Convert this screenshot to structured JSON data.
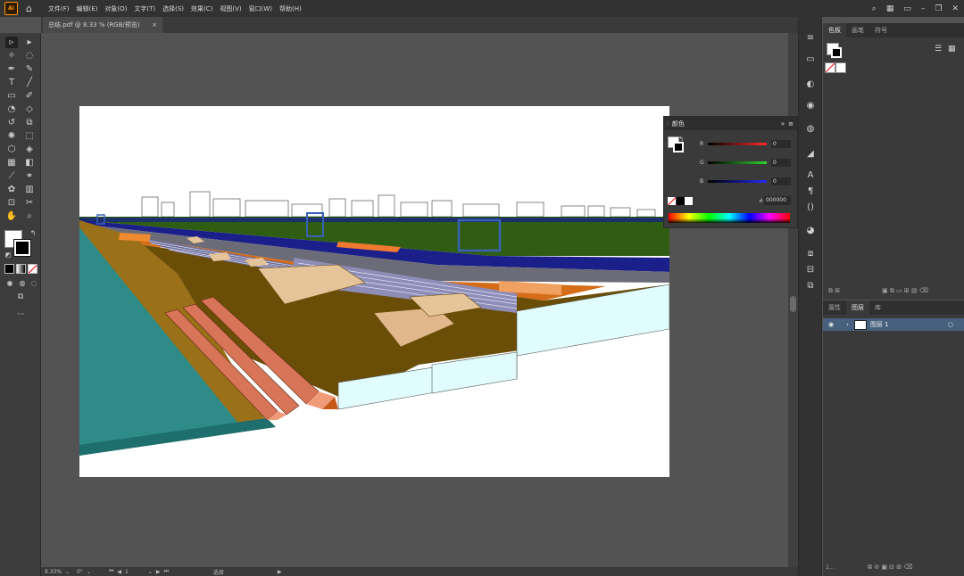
{
  "app": {
    "logo": "Ai"
  },
  "menu": [
    "文件(F)",
    "编辑(E)",
    "对象(O)",
    "文字(T)",
    "选择(S)",
    "效果(C)",
    "视图(V)",
    "窗口(W)",
    "帮助(H)"
  ],
  "document_tab": {
    "title": "总结.pdf @ 8.33 % (RGB/预览)",
    "close": "×"
  },
  "status": {
    "zoom": "8.33%",
    "angle": "0°",
    "artboard": "1",
    "mode": "选择"
  },
  "swatches_panel": {
    "tabs": [
      "色板",
      "画笔",
      "符号"
    ],
    "active": "色板"
  },
  "color_panel": {
    "title": "颜色",
    "channels": [
      {
        "label": "R",
        "value": "0",
        "color": "#ff2a2a"
      },
      {
        "label": "G",
        "value": "0",
        "color": "#2fd12f"
      },
      {
        "label": "B",
        "value": "0",
        "color": "#2a2aff"
      }
    ],
    "hex_symbol": "#",
    "hex": "000000"
  },
  "layers_panel": {
    "tabs": [
      "属性",
      "图层",
      "库"
    ],
    "active": "图层",
    "layers": [
      {
        "name": "图层 1"
      }
    ],
    "count": "1..."
  },
  "colors": {
    "accent": "#ff9a00",
    "selection": "#46607e"
  }
}
